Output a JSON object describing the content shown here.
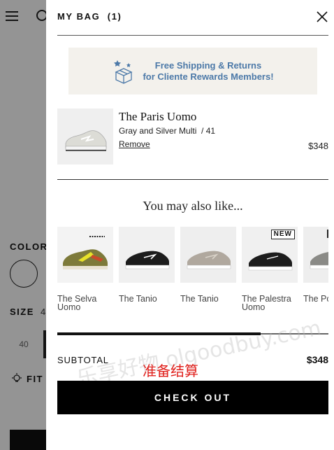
{
  "background": {
    "color_label": "COLOR",
    "size_label": "SIZE",
    "size_extra": "4",
    "size_option": "40",
    "fit_label": "FIT"
  },
  "drawer": {
    "title": "MY BAG  (1)",
    "promo": {
      "line1": "Free Shipping & Returns",
      "line2": "for Cliente Rewards Members!",
      "icon": "box-stars-icon"
    },
    "item": {
      "name": "The Paris Uomo",
      "variant": "Gray and Silver Multi  / 41",
      "remove_label": "Remove",
      "price": "$348"
    },
    "recommendations_title": "You may also like...",
    "recommendations": [
      {
        "name": "The Selva Uomo",
        "badge": ""
      },
      {
        "name": "The Tanio",
        "badge": ""
      },
      {
        "name": "The Tanio",
        "badge": ""
      },
      {
        "name": "The Palestra Uomo",
        "badge": "NEW"
      },
      {
        "name": "The Po Uomo",
        "badge": ""
      }
    ],
    "carousel_progress": 0.75,
    "subtotal_label": "SUBTOTAL",
    "subtotal_value": "$348",
    "annotation": "准备结算",
    "checkout_label": "CHECK OUT",
    "watermark": "乐享好物 olgoodbuy.com"
  },
  "colors": {
    "accent_blue": "#4c79a8",
    "annotation_red": "#e0201c",
    "checkout_bg": "#000000"
  }
}
